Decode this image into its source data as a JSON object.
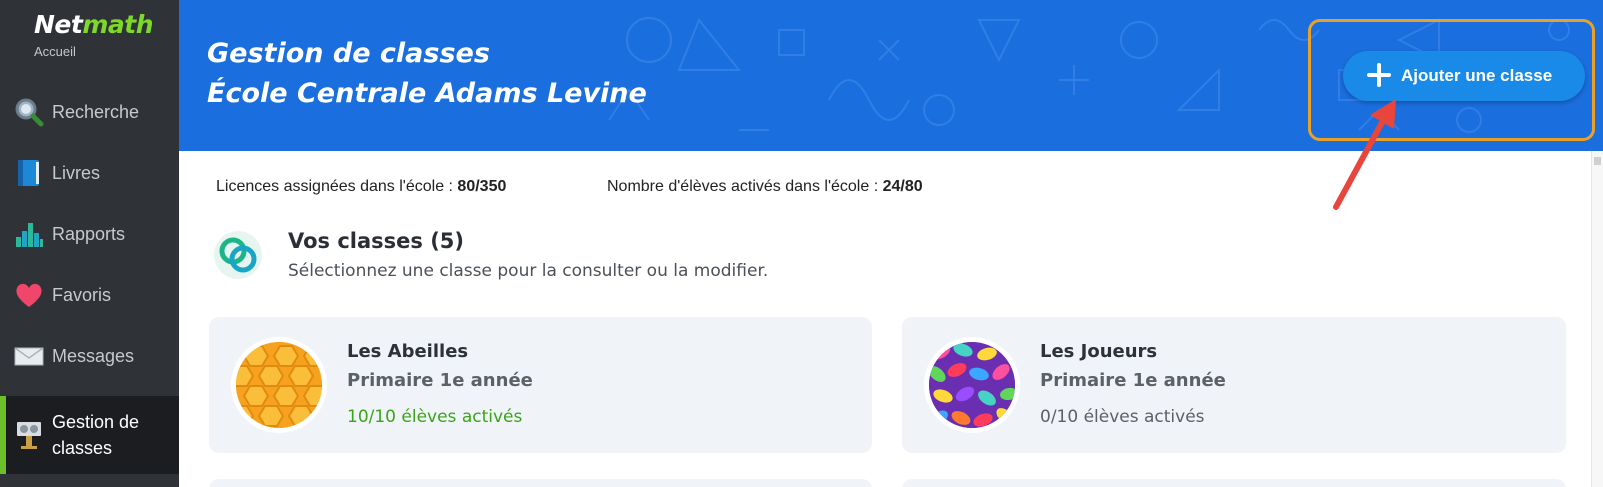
{
  "sidebar": {
    "logo_primary": "Net",
    "logo_secondary": "math",
    "home_label": "Accueil",
    "items": [
      {
        "label": "Recherche",
        "icon": "magnifier-icon"
      },
      {
        "label": "Livres",
        "icon": "book-icon"
      },
      {
        "label": "Rapports",
        "icon": "bar-chart-icon"
      },
      {
        "label": "Favoris",
        "icon": "heart-icon"
      },
      {
        "label": "Messages",
        "icon": "envelope-icon"
      },
      {
        "label": "Gestion de classes",
        "label_line1": "Gestion de",
        "label_line2": "classes",
        "icon": "classroom-icon",
        "active": true
      }
    ]
  },
  "header": {
    "title_line1": "Gestion de classes",
    "title_line2": "École Centrale Adams Levine",
    "add_button_label": "Ajouter une classe"
  },
  "stats": {
    "licences_label": "Licences assignées dans l'école : ",
    "licences_value": "80/350",
    "students_label": "Nombre d'élèves activés dans l'école : ",
    "students_value": "24/80"
  },
  "classes": {
    "title": "Vos classes (5)",
    "subtitle": "Sélectionnez une classe pour la consulter ou la modifier.",
    "cards": [
      {
        "name": "Les Abeilles",
        "grade": "Primaire 1e année",
        "status": "10/10 élèves activés",
        "image": "honeycomb-avatar"
      },
      {
        "name": "Les Joueurs",
        "grade": "Primaire 1e année",
        "status": "0/10 élèves activés",
        "image": "jellybeans-avatar"
      }
    ]
  },
  "colors": {
    "sidebar_bg": "#2f3236",
    "header_bg": "#1a6ede",
    "accent_green": "#6cc12a",
    "button_blue": "#1a8ae8",
    "highlight_orange": "#e8a12a",
    "annotation_red": "#e8453c"
  }
}
